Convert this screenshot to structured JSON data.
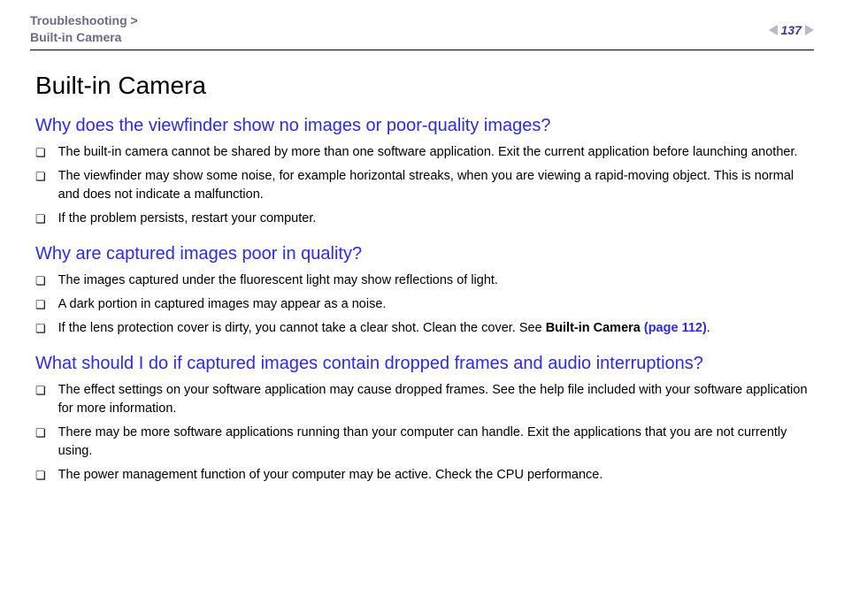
{
  "header": {
    "breadcrumb_line1": "Troubleshooting >",
    "breadcrumb_line2": "Built-in Camera",
    "page_number": "137"
  },
  "title": "Built-in Camera",
  "sections": [
    {
      "heading": "Why does the viewfinder show no images or poor-quality images?",
      "items": [
        {
          "text": "The built-in camera cannot be shared by more than one software application. Exit the current application before launching another."
        },
        {
          "text": "The viewfinder may show some noise, for example horizontal streaks, when you are viewing a rapid-moving object. This is normal and does not indicate a malfunction."
        },
        {
          "text": "If the problem persists, restart your computer."
        }
      ]
    },
    {
      "heading": "Why are captured images poor in quality?",
      "items": [
        {
          "text": "The images captured under the fluorescent light may show reflections of light."
        },
        {
          "text": "A dark portion in captured images may appear as a noise."
        },
        {
          "text_pre": "If the lens protection cover is dirty, you cannot take a clear shot. Clean the cover. See ",
          "bold": "Built-in Camera ",
          "link": "(page 112)",
          "text_post": "."
        }
      ]
    },
    {
      "heading": "What should I do if captured images contain dropped frames and audio interruptions?",
      "items": [
        {
          "text": "The effect settings on your software application may cause dropped frames. See the help file included with your software application for more information."
        },
        {
          "text": "There may be more software applications running than your computer can handle. Exit the applications that you are not currently using."
        },
        {
          "text": "The power management function of your computer may be active. Check the CPU performance."
        }
      ]
    }
  ]
}
